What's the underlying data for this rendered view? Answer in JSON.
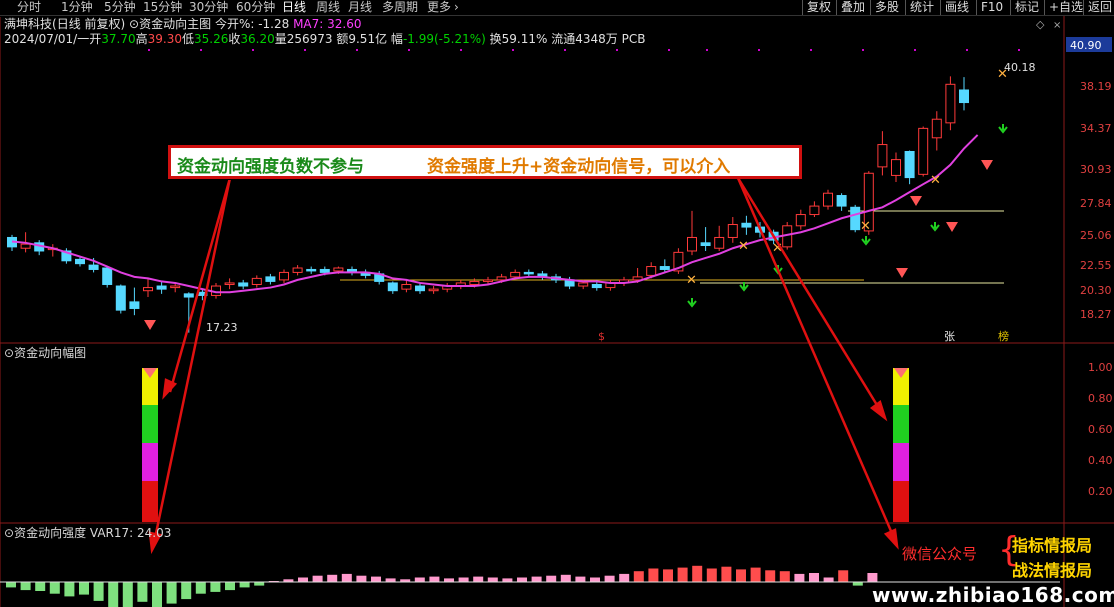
{
  "toolbar": {
    "tabs": [
      "分时",
      "1分钟",
      "5分钟",
      "15分钟",
      "30分钟",
      "60分钟",
      "日线",
      "周线",
      "月线",
      "多周期",
      "更多"
    ],
    "more_arrow": "›",
    "buttons": [
      "复权",
      "叠加",
      "多股",
      "统计",
      "画线",
      "F10",
      "标记",
      "+自选",
      "返回"
    ]
  },
  "header": {
    "stock": "满坤科技",
    "mode": "(日线 前复权)",
    "indicator": "资金动向主图",
    "open_change": "今开%: -1.28",
    "ma": "MA7: 32.60",
    "date": "2024/07/01/一",
    "open_label": "开",
    "open_value": "37.70",
    "high_label": "高",
    "high_value": "39.30",
    "low_label": "低",
    "low_value": "35.26",
    "close_label": "收",
    "close_value": "36.20",
    "volume": "量256973",
    "amount": "额9.51亿",
    "change_label": "幅",
    "change_value": "-1.99(-5.21%)",
    "turnover": "换59.11%",
    "float": "流通4348万",
    "sector": "PCB"
  },
  "price_axis": {
    "current": "40.90",
    "ticks": [
      "38.19",
      "34.37",
      "30.93",
      "27.84",
      "25.06",
      "22.55",
      "20.30",
      "18.27"
    ]
  },
  "chart_marks": {
    "high": "40.18",
    "low": "17.23",
    "dollar": "$",
    "zhang": "张",
    "bang": "榜"
  },
  "annotation": {
    "left": "资金动向强度负数不参与",
    "right": "资金强度上升+资金动向信号，可以介入"
  },
  "panel2": {
    "title": "资金动向幅图",
    "ticks": [
      "1.00",
      "0.80",
      "0.60",
      "0.40",
      "0.20"
    ]
  },
  "panel3": {
    "title": "资金动向强度",
    "var": "VAR17: 24.03"
  },
  "watermark": {
    "wechat": "微信公众号",
    "brace": "{",
    "brand1": "指标情报局",
    "brand2": "战法情报局",
    "url": "www.zhibiao168.com"
  },
  "colors": {
    "up": "#ff3a3a",
    "down": "#56d8ff",
    "ma": "#e040e0",
    "arrow_red": "#e01010",
    "buy_arrow": "#20d020",
    "strength_pos": "#ff4d4d",
    "strength_pink": "#ff9acd",
    "strength_neg": "#7fe07f"
  },
  "chart_data": {
    "type": "candlestick",
    "y_axis_ticks": [
      38.19,
      34.37,
      30.93,
      27.84,
      25.06,
      22.55,
      20.3,
      18.27
    ],
    "candles": [
      {
        "o": 23.4,
        "c": 22.7,
        "h": 23.6,
        "l": 22.4
      },
      {
        "o": 22.6,
        "c": 22.9,
        "h": 23.8,
        "l": 22.3
      },
      {
        "o": 23.0,
        "c": 22.4,
        "h": 23.2,
        "l": 22.1
      },
      {
        "o": 22.5,
        "c": 22.6,
        "h": 22.9,
        "l": 22.0
      },
      {
        "o": 22.4,
        "c": 21.7,
        "h": 22.6,
        "l": 21.5
      },
      {
        "o": 21.8,
        "c": 21.5,
        "h": 22.0,
        "l": 21.3
      },
      {
        "o": 21.4,
        "c": 21.1,
        "h": 21.9,
        "l": 20.9
      },
      {
        "o": 21.2,
        "c": 20.1,
        "h": 21.3,
        "l": 19.9
      },
      {
        "o": 20.0,
        "c": 18.5,
        "h": 20.1,
        "l": 18.3
      },
      {
        "o": 19.0,
        "c": 18.6,
        "h": 19.9,
        "l": 18.2
      },
      {
        "o": 19.7,
        "c": 19.9,
        "h": 20.5,
        "l": 19.3
      },
      {
        "o": 20.0,
        "c": 19.8,
        "h": 20.3,
        "l": 19.5
      },
      {
        "o": 19.9,
        "c": 20.0,
        "h": 20.2,
        "l": 19.6
      },
      {
        "o": 19.5,
        "c": 19.3,
        "h": 19.6,
        "l": 17.2
      },
      {
        "o": 19.6,
        "c": 19.4,
        "h": 19.8,
        "l": 19.1
      },
      {
        "o": 19.4,
        "c": 20.0,
        "h": 20.2,
        "l": 19.2
      },
      {
        "o": 20.1,
        "c": 20.2,
        "h": 20.5,
        "l": 19.8
      },
      {
        "o": 20.2,
        "c": 20.0,
        "h": 20.4,
        "l": 19.8
      },
      {
        "o": 20.1,
        "c": 20.5,
        "h": 20.7,
        "l": 19.9
      },
      {
        "o": 20.6,
        "c": 20.3,
        "h": 20.8,
        "l": 20.1
      },
      {
        "o": 20.4,
        "c": 20.9,
        "h": 21.1,
        "l": 20.2
      },
      {
        "o": 20.9,
        "c": 21.2,
        "h": 21.4,
        "l": 20.7
      },
      {
        "o": 21.1,
        "c": 21.0,
        "h": 21.3,
        "l": 20.8
      },
      {
        "o": 21.1,
        "c": 20.9,
        "h": 21.3,
        "l": 20.7
      },
      {
        "o": 21.0,
        "c": 21.2,
        "h": 21.3,
        "l": 20.8
      },
      {
        "o": 21.1,
        "c": 20.9,
        "h": 21.3,
        "l": 20.7
      },
      {
        "o": 20.9,
        "c": 20.7,
        "h": 21.1,
        "l": 20.5
      },
      {
        "o": 20.8,
        "c": 20.3,
        "h": 21.0,
        "l": 20.1
      },
      {
        "o": 20.2,
        "c": 19.7,
        "h": 20.3,
        "l": 19.5
      },
      {
        "o": 19.8,
        "c": 20.1,
        "h": 20.4,
        "l": 19.6
      },
      {
        "o": 20.0,
        "c": 19.7,
        "h": 20.2,
        "l": 19.5
      },
      {
        "o": 19.7,
        "c": 19.8,
        "h": 20.0,
        "l": 19.5
      },
      {
        "o": 19.8,
        "c": 20.0,
        "h": 20.2,
        "l": 19.6
      },
      {
        "o": 20.0,
        "c": 20.2,
        "h": 20.4,
        "l": 19.8
      },
      {
        "o": 20.1,
        "c": 20.3,
        "h": 20.5,
        "l": 19.9
      },
      {
        "o": 20.3,
        "c": 20.4,
        "h": 20.6,
        "l": 20.1
      },
      {
        "o": 20.4,
        "c": 20.6,
        "h": 20.8,
        "l": 20.2
      },
      {
        "o": 20.6,
        "c": 20.9,
        "h": 21.1,
        "l": 20.4
      },
      {
        "o": 20.9,
        "c": 20.8,
        "h": 21.1,
        "l": 20.6
      },
      {
        "o": 20.8,
        "c": 20.6,
        "h": 21.0,
        "l": 20.4
      },
      {
        "o": 20.6,
        "c": 20.4,
        "h": 20.8,
        "l": 20.2
      },
      {
        "o": 20.4,
        "c": 20.0,
        "h": 20.6,
        "l": 19.8
      },
      {
        "o": 20.0,
        "c": 20.2,
        "h": 20.4,
        "l": 19.8
      },
      {
        "o": 20.1,
        "c": 19.9,
        "h": 20.4,
        "l": 19.7
      },
      {
        "o": 19.9,
        "c": 20.2,
        "h": 20.4,
        "l": 19.7
      },
      {
        "o": 20.2,
        "c": 20.4,
        "h": 20.6,
        "l": 20.0
      },
      {
        "o": 20.4,
        "c": 20.6,
        "h": 21.2,
        "l": 20.2
      },
      {
        "o": 20.7,
        "c": 21.3,
        "h": 21.6,
        "l": 20.5
      },
      {
        "o": 21.3,
        "c": 21.1,
        "h": 21.8,
        "l": 20.9
      },
      {
        "o": 21.0,
        "c": 22.3,
        "h": 22.6,
        "l": 20.8
      },
      {
        "o": 22.4,
        "c": 23.4,
        "h": 25.5,
        "l": 22.1
      },
      {
        "o": 23.0,
        "c": 22.8,
        "h": 24.2,
        "l": 22.4
      },
      {
        "o": 22.6,
        "c": 23.4,
        "h": 24.3,
        "l": 22.4
      },
      {
        "o": 23.4,
        "c": 24.4,
        "h": 25.0,
        "l": 23.0
      },
      {
        "o": 24.5,
        "c": 24.2,
        "h": 25.1,
        "l": 23.6
      },
      {
        "o": 24.2,
        "c": 23.8,
        "h": 24.6,
        "l": 23.4
      },
      {
        "o": 23.8,
        "c": 23.2,
        "h": 24.0,
        "l": 22.9
      },
      {
        "o": 22.7,
        "c": 24.3,
        "h": 24.6,
        "l": 22.5
      },
      {
        "o": 24.3,
        "c": 25.2,
        "h": 25.6,
        "l": 24.0
      },
      {
        "o": 25.2,
        "c": 25.9,
        "h": 26.3,
        "l": 25.0
      },
      {
        "o": 25.9,
        "c": 27.0,
        "h": 27.3,
        "l": 25.6
      },
      {
        "o": 26.8,
        "c": 25.9,
        "h": 27.0,
        "l": 25.5
      },
      {
        "o": 25.8,
        "c": 24.0,
        "h": 26.0,
        "l": 23.8
      },
      {
        "o": 23.9,
        "c": 28.8,
        "h": 29.0,
        "l": 23.6
      },
      {
        "o": 29.4,
        "c": 31.6,
        "h": 33.0,
        "l": 28.6
      },
      {
        "o": 28.6,
        "c": 30.1,
        "h": 30.8,
        "l": 28.0
      },
      {
        "o": 30.9,
        "c": 28.4,
        "h": 31.0,
        "l": 27.8
      },
      {
        "o": 28.7,
        "c": 33.3,
        "h": 33.5,
        "l": 28.5
      },
      {
        "o": 32.3,
        "c": 34.3,
        "h": 35.2,
        "l": 31.0
      },
      {
        "o": 33.9,
        "c": 38.4,
        "h": 39.4,
        "l": 33.1
      },
      {
        "o": 37.7,
        "c": 36.2,
        "h": 39.3,
        "l": 35.3
      }
    ],
    "ma7": [
      23.1,
      23.0,
      22.8,
      22.6,
      22.3,
      22.0,
      21.7,
      21.3,
      20.9,
      20.6,
      20.5,
      20.3,
      20.2,
      20.0,
      19.8,
      19.6,
      19.6,
      19.7,
      19.8,
      19.9,
      20.1,
      20.4,
      20.6,
      20.8,
      20.9,
      20.9,
      20.9,
      20.8,
      20.5,
      20.4,
      20.2,
      20.1,
      20.0,
      20.0,
      20.0,
      20.1,
      20.3,
      20.5,
      20.6,
      20.6,
      20.5,
      20.4,
      20.3,
      20.3,
      20.2,
      20.2,
      20.3,
      20.6,
      20.9,
      21.2,
      21.6,
      21.9,
      22.2,
      22.6,
      22.9,
      23.2,
      23.4,
      23.6,
      23.8,
      24.1,
      24.5,
      24.9,
      25.2,
      25.5,
      25.8,
      26.4,
      27.1,
      27.8,
      28.5,
      29.6,
      31.2,
      32.6
    ],
    "strength_panel": {
      "title": "资金动向强度",
      "var17": 24.03,
      "values": [
        -0.6,
        -0.9,
        -1.0,
        -1.3,
        -1.6,
        -1.4,
        -2.1,
        -3.0,
        -3.6,
        -2.2,
        -2.8,
        -2.4,
        -1.9,
        -1.3,
        -1.1,
        -0.9,
        -0.6,
        -0.4,
        0.0,
        0.3,
        0.5,
        0.7,
        0.8,
        0.9,
        0.7,
        0.6,
        0.4,
        0.3,
        0.5,
        0.6,
        0.4,
        0.5,
        0.6,
        0.5,
        0.4,
        0.5,
        0.6,
        0.7,
        0.8,
        0.6,
        0.5,
        0.7,
        0.9,
        1.2,
        1.5,
        1.4,
        1.6,
        1.8,
        1.5,
        1.7,
        1.4,
        1.6,
        1.3,
        1.2,
        0.9,
        1.0,
        0.5,
        1.3,
        -0.4,
        1.0
      ]
    },
    "amplitude_panel": {
      "title": "资金动向幅图",
      "ticks": [
        1.0,
        0.8,
        0.6,
        0.4,
        0.2
      ]
    }
  }
}
